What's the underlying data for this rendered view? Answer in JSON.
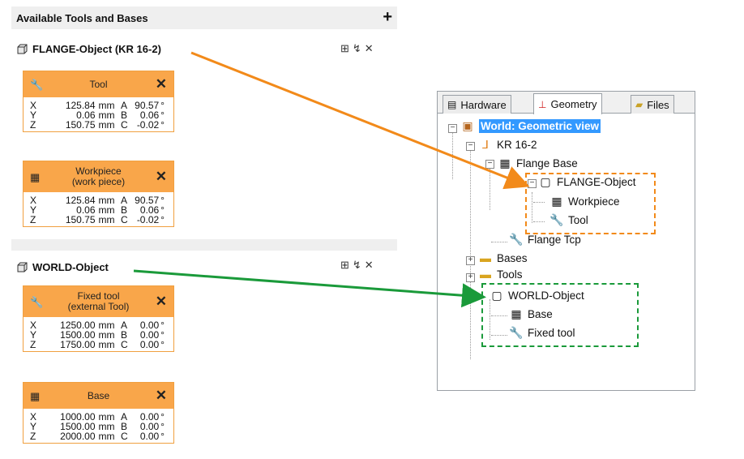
{
  "left_panel": {
    "title": "Available Tools and Bases",
    "plus": "+",
    "flange_object": {
      "title": "FLANGE-Object (KR 16-2)",
      "actions": "⊞↯✕",
      "cards": [
        {
          "label": "Tool",
          "icon": "wrench-icon",
          "rows": [
            {
              "ax": "X",
              "v1": "125.84",
              "u1": "mm",
              "ax2": "A",
              "v2": "90.57",
              "u2": "°"
            },
            {
              "ax": "Y",
              "v1": "0.06",
              "u1": "mm",
              "ax2": "B",
              "v2": "0.06",
              "u2": "°"
            },
            {
              "ax": "Z",
              "v1": "150.75",
              "u1": "mm",
              "ax2": "C",
              "v2": "-0.02",
              "u2": "°"
            }
          ]
        },
        {
          "label": "Workpiece (work piece)",
          "label_line1": "Workpiece",
          "label_line2": "(work piece)",
          "icon": "workpiece-icon",
          "rows": [
            {
              "ax": "X",
              "v1": "125.84",
              "u1": "mm",
              "ax2": "A",
              "v2": "90.57",
              "u2": "°"
            },
            {
              "ax": "Y",
              "v1": "0.06",
              "u1": "mm",
              "ax2": "B",
              "v2": "0.06",
              "u2": "°"
            },
            {
              "ax": "Z",
              "v1": "150.75",
              "u1": "mm",
              "ax2": "C",
              "v2": "-0.02",
              "u2": "°"
            }
          ]
        }
      ]
    },
    "world_object": {
      "title": "WORLD-Object",
      "actions": "⊞↯✕",
      "cards": [
        {
          "label_line1": "Fixed tool",
          "label_line2": "(external Tool)",
          "icon": "wrench-icon",
          "rows": [
            {
              "ax": "X",
              "v1": "1250.00",
              "u1": "mm",
              "ax2": "A",
              "v2": "0.00",
              "u2": "°"
            },
            {
              "ax": "Y",
              "v1": "1500.00",
              "u1": "mm",
              "ax2": "B",
              "v2": "0.00",
              "u2": "°"
            },
            {
              "ax": "Z",
              "v1": "1750.00",
              "u1": "mm",
              "ax2": "C",
              "v2": "0.00",
              "u2": "°"
            }
          ]
        },
        {
          "label": "Base",
          "icon": "base-icon",
          "rows": [
            {
              "ax": "X",
              "v1": "1000.00",
              "u1": "mm",
              "ax2": "A",
              "v2": "0.00",
              "u2": "°"
            },
            {
              "ax": "Y",
              "v1": "1500.00",
              "u1": "mm",
              "ax2": "B",
              "v2": "0.00",
              "u2": "°"
            },
            {
              "ax": "Z",
              "v1": "2000.00",
              "u1": "mm",
              "ax2": "C",
              "v2": "0.00",
              "u2": "°"
            }
          ]
        }
      ]
    }
  },
  "tree_panel": {
    "tabs": [
      {
        "label": "Hardware",
        "icon": "hardware-icon",
        "active": false
      },
      {
        "label": "Geometry",
        "icon": "geometry-icon",
        "active": true
      },
      {
        "label": "Files",
        "icon": "files-icon",
        "active": false
      }
    ],
    "nodes": {
      "root": "World: Geometric view",
      "robot": "KR 16-2",
      "flange_base": "Flange Base",
      "flange_object": "FLANGE-Object",
      "workpiece": "Workpiece",
      "tool": "Tool",
      "flange_tcp": "Flange Tcp",
      "bases": "Bases",
      "tools": "Tools",
      "world_object": "WORLD-Object",
      "base": "Base",
      "fixed_tool": "Fixed tool"
    }
  },
  "colors": {
    "card_header": "#f9a64a",
    "arrow_orange": "#f28a1a",
    "arrow_green": "#1a9a3a",
    "selection": "#3399ff"
  }
}
